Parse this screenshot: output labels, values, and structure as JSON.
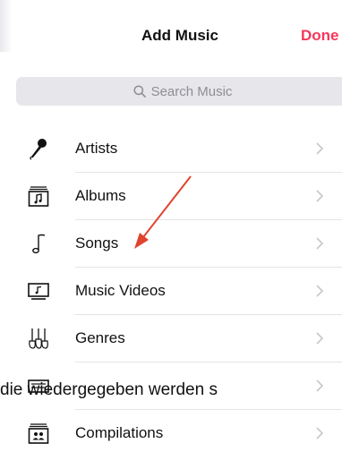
{
  "nav": {
    "title": "Add Music",
    "done_label": "Done"
  },
  "search": {
    "placeholder": "Search Music",
    "icon": "search-icon"
  },
  "list": {
    "items": [
      {
        "label": "Artists",
        "icon": "microphone-icon"
      },
      {
        "label": "Albums",
        "icon": "album-icon"
      },
      {
        "label": "Songs",
        "icon": "music-note-icon"
      },
      {
        "label": "Music Videos",
        "icon": "music-video-icon"
      },
      {
        "label": "Genres",
        "icon": "guitars-icon"
      },
      {
        "label": "",
        "icon": "composers-icon"
      },
      {
        "label": "Compilations",
        "icon": "compilations-icon"
      }
    ]
  },
  "overlay_caption": "die wiedergegeben werden s",
  "colors": {
    "accent": "#f5375a",
    "arrow": "#e0442e",
    "chevron": "#c7c7cc",
    "search_bg": "#e6e6eb"
  }
}
